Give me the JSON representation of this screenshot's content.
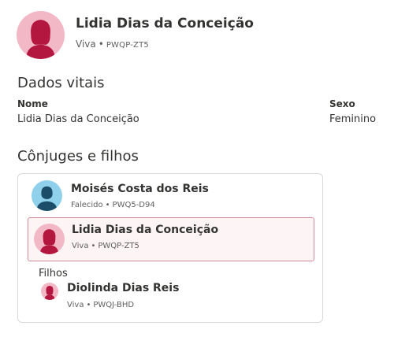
{
  "header": {
    "name": "Lidia Dias da Conceição",
    "status": "Viva",
    "separator": "•",
    "person_id": "PWQP-ZT5",
    "avatar": "female-avatar-icon"
  },
  "vitals": {
    "title": "Dados vitais",
    "name_label": "Nome",
    "name_value": "Lidia Dias da Conceição",
    "sex_label": "Sexo",
    "sex_value": "Feminino"
  },
  "family": {
    "title": "Cônjuges e filhos",
    "spouse": {
      "name": "Moisés Costa dos Reis",
      "status": "Falecido",
      "person_id": "PWQ5-D94",
      "avatar": "male-avatar-icon"
    },
    "self": {
      "name": "Lidia Dias da Conceição",
      "status": "Viva",
      "person_id": "PWQP-ZT5",
      "avatar": "female-avatar-icon"
    },
    "children_label": "Filhos",
    "children": [
      {
        "name": "Diolinda Dias Reis",
        "status": "Viva",
        "person_id": "PWQJ-BHD",
        "avatar": "female-avatar-icon"
      }
    ],
    "separator": "•"
  },
  "colors": {
    "female_bg": "#f3b8c6",
    "female_figure": "#b3163f",
    "male_bg": "#8fd0ea",
    "male_figure": "#1c4d68",
    "highlight_border": "#d7889a",
    "highlight_bg": "#fdf4f5"
  }
}
